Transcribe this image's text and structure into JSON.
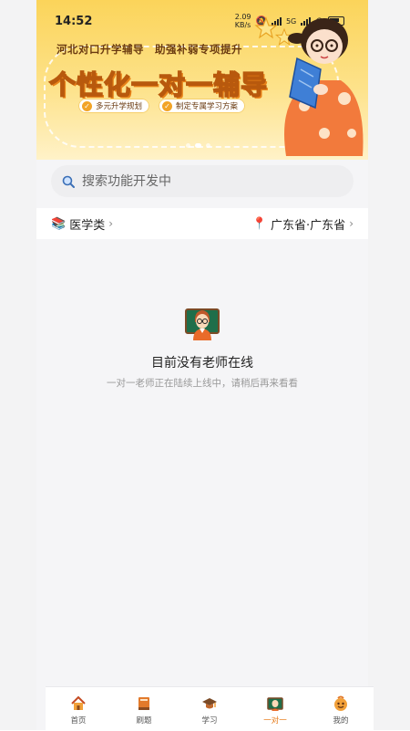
{
  "status": {
    "time": "14:52",
    "net_speed_line1": "2.09",
    "net_speed_line2": "KB/s",
    "network": "5G"
  },
  "banner": {
    "subtitle": "河北对口升学辅导　助强补弱专项提升",
    "title": "个性化一对一辅导",
    "tags": [
      "多元升学规划",
      "制定专属学习方案"
    ],
    "page_count": 3,
    "active_page": 1
  },
  "search": {
    "placeholder": "搜索功能开发中"
  },
  "filter": {
    "category": "医学类",
    "location": "广东省·广东省"
  },
  "empty": {
    "title": "目前没有老师在线",
    "description": "一对一老师正在陆续上线中，请稍后再来看看"
  },
  "tabbar": {
    "items": [
      {
        "label": "首页",
        "icon": "home-icon",
        "active": false
      },
      {
        "label": "刷题",
        "icon": "book-icon",
        "active": false
      },
      {
        "label": "学习",
        "icon": "graduation-cap-icon",
        "active": false
      },
      {
        "label": "一对一",
        "icon": "one-on-one-icon",
        "active": true
      },
      {
        "label": "我的",
        "icon": "profile-icon",
        "active": false
      }
    ]
  },
  "colors": {
    "accent": "#e67b1a",
    "banner_yellow": "#fbd45a",
    "page_bg": "#f5f5f7"
  }
}
